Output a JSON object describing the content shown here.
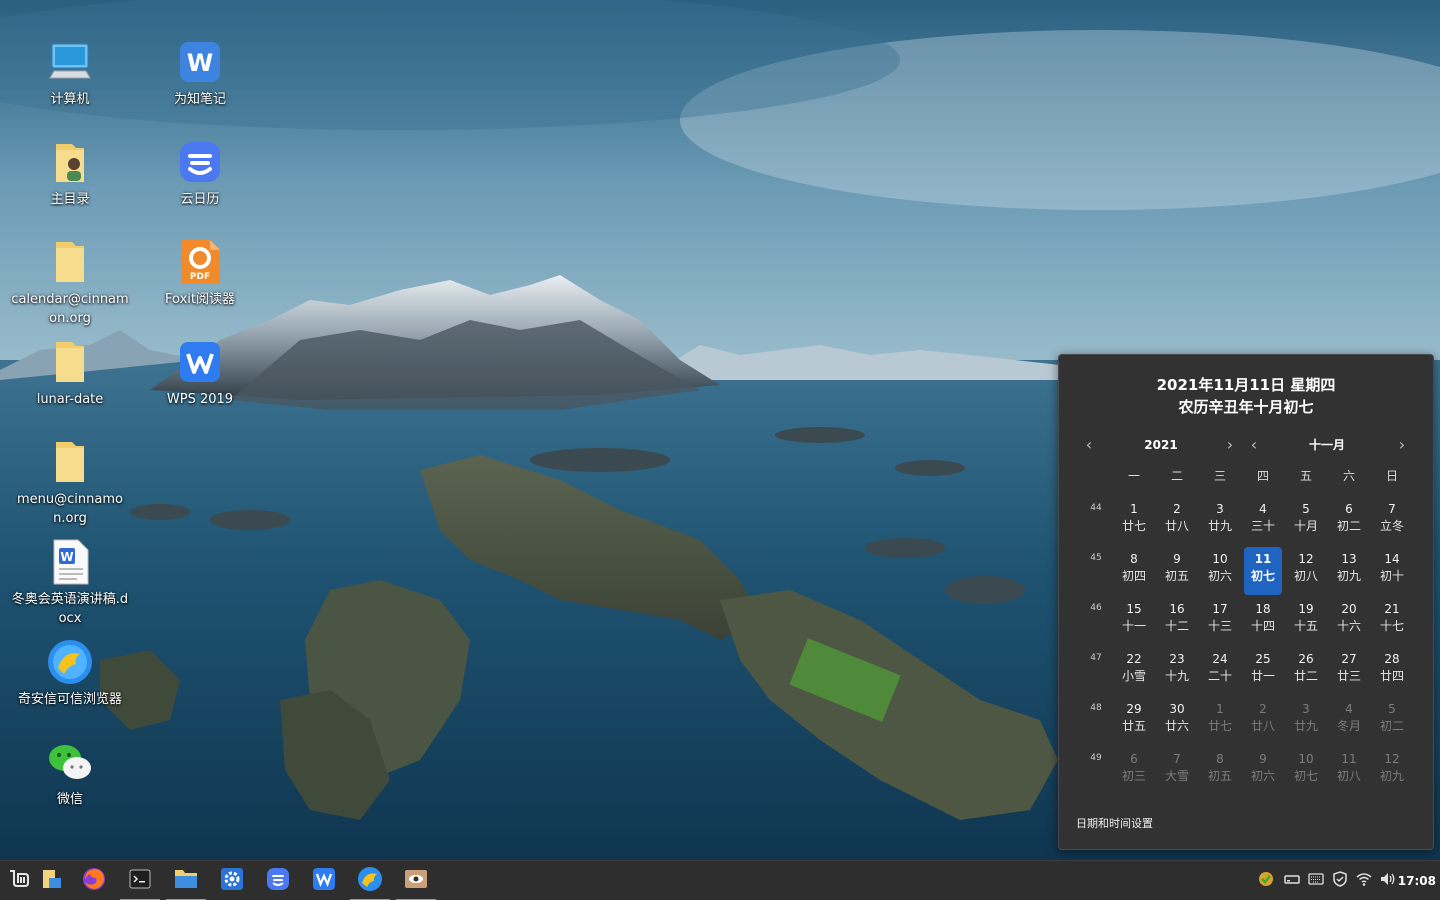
{
  "desktop": {
    "icons": [
      {
        "label": "计算机",
        "icon": "computer-icon"
      },
      {
        "label": "为知笔记",
        "icon": "wiz-note-icon"
      },
      {
        "label": "主目录",
        "icon": "home-folder-icon"
      },
      {
        "label": "云日历",
        "icon": "cloud-calendar-icon"
      },
      {
        "label": "calendar@cinnamon.org",
        "icon": "folder-icon"
      },
      {
        "label": "Foxit阅读器",
        "icon": "foxit-pdf-icon"
      },
      {
        "label": "lunar-date",
        "icon": "folder-icon"
      },
      {
        "label": "WPS 2019",
        "icon": "wps-icon"
      },
      {
        "label": "menu@cinnamon.org",
        "icon": "folder-icon"
      },
      {
        "label": "冬奥会英语演讲稿.docx",
        "icon": "word-document-icon"
      },
      {
        "label": "奇安信可信浏览器",
        "icon": "qianxin-browser-icon"
      },
      {
        "label": "微信",
        "icon": "wechat-icon"
      }
    ]
  },
  "calendar": {
    "date_line": "2021年11月11日 星期四",
    "lunar_line": "农历辛丑年十月初七",
    "year": "2021",
    "month": "十一月",
    "weekdays": [
      "一",
      "二",
      "三",
      "四",
      "五",
      "六",
      "日"
    ],
    "weeks": [
      {
        "num": "44",
        "days": [
          [
            "1",
            "廿七",
            0
          ],
          [
            "2",
            "廿八",
            0
          ],
          [
            "3",
            "廿九",
            0
          ],
          [
            "4",
            "三十",
            0
          ],
          [
            "5",
            "十月",
            0
          ],
          [
            "6",
            "初二",
            0
          ],
          [
            "7",
            "立冬",
            0
          ]
        ]
      },
      {
        "num": "45",
        "days": [
          [
            "8",
            "初四",
            0
          ],
          [
            "9",
            "初五",
            0
          ],
          [
            "10",
            "初六",
            0
          ],
          [
            "11",
            "初七",
            2
          ],
          [
            "12",
            "初八",
            0
          ],
          [
            "13",
            "初九",
            0
          ],
          [
            "14",
            "初十",
            0
          ]
        ]
      },
      {
        "num": "46",
        "days": [
          [
            "15",
            "十一",
            0
          ],
          [
            "16",
            "十二",
            0
          ],
          [
            "17",
            "十三",
            0
          ],
          [
            "18",
            "十四",
            0
          ],
          [
            "19",
            "十五",
            0
          ],
          [
            "20",
            "十六",
            0
          ],
          [
            "21",
            "十七",
            0
          ]
        ]
      },
      {
        "num": "47",
        "days": [
          [
            "22",
            "小雪",
            0
          ],
          [
            "23",
            "十九",
            0
          ],
          [
            "24",
            "二十",
            0
          ],
          [
            "25",
            "廿一",
            0
          ],
          [
            "26",
            "廿二",
            0
          ],
          [
            "27",
            "廿三",
            0
          ],
          [
            "28",
            "廿四",
            0
          ]
        ]
      },
      {
        "num": "48",
        "days": [
          [
            "29",
            "廿五",
            0
          ],
          [
            "30",
            "廿六",
            0
          ],
          [
            "1",
            "廿七",
            1
          ],
          [
            "2",
            "廿八",
            1
          ],
          [
            "3",
            "廿九",
            1
          ],
          [
            "4",
            "冬月",
            1
          ],
          [
            "5",
            "初二",
            1
          ]
        ]
      },
      {
        "num": "49",
        "days": [
          [
            "6",
            "初三",
            1
          ],
          [
            "7",
            "大雪",
            1
          ],
          [
            "8",
            "初五",
            1
          ],
          [
            "9",
            "初六",
            1
          ],
          [
            "10",
            "初七",
            1
          ],
          [
            "11",
            "初八",
            1
          ],
          [
            "12",
            "初九",
            1
          ]
        ]
      }
    ],
    "settings_label": "日期和时间设置"
  },
  "taskbar": {
    "apps": [
      {
        "icon": "mint-menu-icon",
        "active": false
      },
      {
        "icon": "show-desktop-icon",
        "active": false
      },
      {
        "icon": "firefox-icon",
        "active": false
      },
      {
        "icon": "terminal-icon",
        "active": true
      },
      {
        "icon": "file-manager-icon",
        "active": true
      },
      {
        "icon": "system-settings-icon",
        "active": false
      },
      {
        "icon": "cloud-calendar-icon",
        "active": false
      },
      {
        "icon": "wps-icon",
        "active": false
      },
      {
        "icon": "qianxin-browser-icon",
        "active": true
      },
      {
        "icon": "screen-eye-icon",
        "active": true
      }
    ],
    "tray": [
      "update-manager-icon",
      "removable-drive-icon",
      "keyboard-icon",
      "shield-icon",
      "wifi-icon",
      "volume-icon"
    ],
    "clock": "17:08"
  }
}
